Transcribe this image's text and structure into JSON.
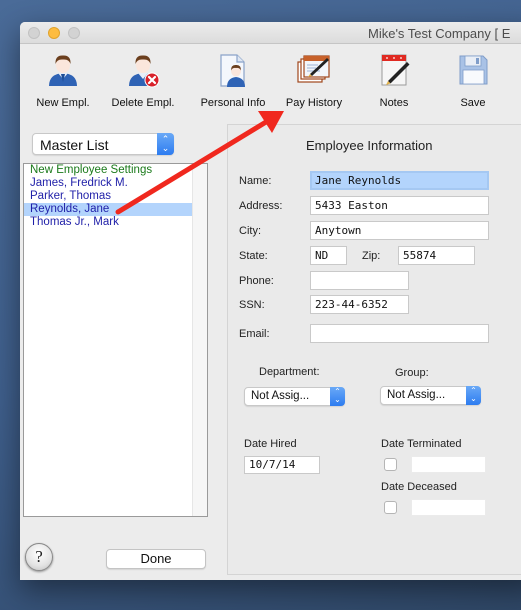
{
  "window": {
    "title": "Mike's Test Company [ E",
    "traffic_lights": [
      "close",
      "minimize",
      "zoom"
    ]
  },
  "toolbar": {
    "items": [
      {
        "label": "New Empl.",
        "icon": "person-icon"
      },
      {
        "label": "Delete Empl.",
        "icon": "person-delete-icon"
      },
      {
        "label": "Personal Info",
        "icon": "personal-info-document-icon"
      },
      {
        "label": "Pay History",
        "icon": "pay-history-icon"
      },
      {
        "label": "Notes",
        "icon": "notes-pen-icon"
      },
      {
        "label": "Save",
        "icon": "floppy-disk-icon"
      }
    ]
  },
  "sidebar": {
    "list_select": {
      "value": "Master List"
    },
    "employees": [
      {
        "name": "New Employee Settings",
        "color": "#1a7a1a",
        "selected": false
      },
      {
        "name": "James, Fredrick M.",
        "color": "#1f1fa8",
        "selected": false
      },
      {
        "name": "Parker, Thomas",
        "color": "#1f1fa8",
        "selected": false
      },
      {
        "name": "Reynolds, Jane",
        "color": "#1f1fa8",
        "selected": true
      },
      {
        "name": "Thomas Jr., Mark",
        "color": "#1f1fa8",
        "selected": false
      }
    ],
    "help_label": "?",
    "done_label": "Done"
  },
  "employee_info": {
    "title": "Employee Information",
    "name": {
      "label": "Name:",
      "value": "Jane Reynolds"
    },
    "address": {
      "label": "Address:",
      "value": "5433 Easton"
    },
    "city": {
      "label": "City:",
      "value": "Anytown"
    },
    "state": {
      "label": "State:",
      "value": "ND"
    },
    "zip": {
      "label": "Zip:",
      "value": "55874"
    },
    "phone": {
      "label": "Phone:",
      "value": ""
    },
    "ssn": {
      "label": "SSN:",
      "value": "223-44-6352"
    },
    "email": {
      "label": "Email:",
      "value": ""
    },
    "department": {
      "label": "Department:",
      "value": "Not Assig..."
    },
    "group": {
      "label": "Group:",
      "value": "Not Assig..."
    },
    "date_hired": {
      "label": "Date Hired",
      "value": "10/7/14"
    },
    "date_terminated": {
      "label": "Date Terminated",
      "checked": false,
      "value": ""
    },
    "date_deceased": {
      "label": "Date Deceased",
      "checked": false,
      "value": ""
    }
  },
  "annotation": {
    "type": "arrow",
    "color": "#f0281e",
    "from": "Reynolds, Jane",
    "to": "Pay History"
  },
  "colors": {
    "selection": "#b3d4fc",
    "accent_blue": "#2d7cf0",
    "minimize_yellow": "#fdbc40"
  }
}
